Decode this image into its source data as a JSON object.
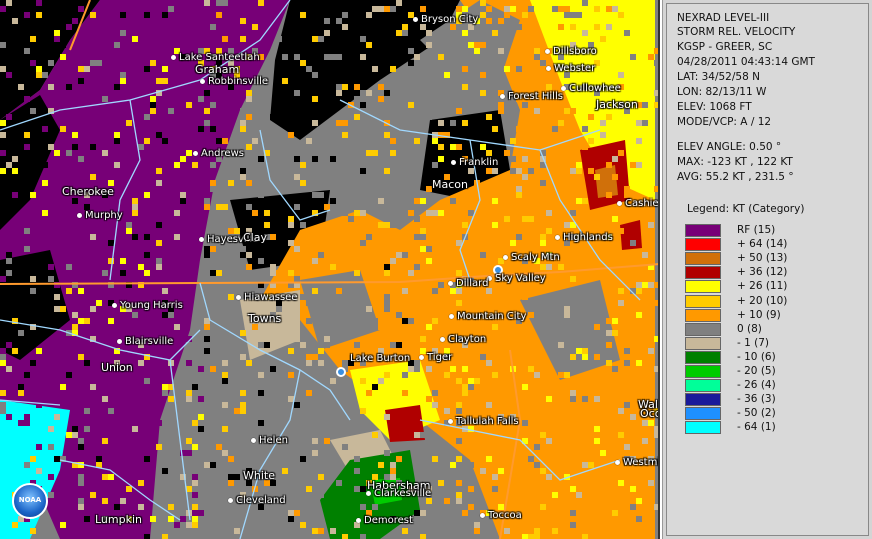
{
  "info": {
    "lines_top": [
      "NEXRAD LEVEL-III",
      "STORM REL. VELOCITY",
      "KGSP - GREER, SC",
      "04/28/2011 04:43:14 GMT",
      "LAT: 34/52/58 N",
      "LON: 82/13/11 W",
      "ELEV: 1068 FT",
      "MODE/VCP: A / 12"
    ],
    "lines_stats": [
      "ELEV ANGLE: 0.50 °",
      "MAX: -123 KT , 122 KT",
      "AVG: 55.2 KT , 231.5 °"
    ]
  },
  "legend": {
    "title": "Legend: KT (Category)",
    "items": [
      {
        "label": "RF  (15)",
        "color": "#770077"
      },
      {
        "label": "+ 64  (14)",
        "color": "#ff0000"
      },
      {
        "label": "+ 50  (13)",
        "color": "#d0700a"
      },
      {
        "label": "+ 36  (12)",
        "color": "#b00000"
      },
      {
        "label": "+ 26  (11)",
        "color": "#ffff00"
      },
      {
        "label": "+ 20  (10)",
        "color": "#ffcc00"
      },
      {
        "label": "+ 10  (9)",
        "color": "#ff9900"
      },
      {
        "label": "0  (8)",
        "color": "#808080"
      },
      {
        "label": "- 1  (7)",
        "color": "#c8b89a"
      },
      {
        "label": "- 10  (6)",
        "color": "#008000"
      },
      {
        "label": "- 20  (5)",
        "color": "#00cc00"
      },
      {
        "label": "- 26  (4)",
        "color": "#00ff99"
      },
      {
        "label": "- 36  (3)",
        "color": "#1a1a9a"
      },
      {
        "label": "- 50  (2)",
        "color": "#1e90ff"
      },
      {
        "label": "- 64  (1)",
        "color": "#00ffff"
      }
    ]
  },
  "places": [
    {
      "name": "Bryson City",
      "dot": true
    },
    {
      "name": "Lake Santeetlah",
      "dot": true
    },
    {
      "name": "Graham",
      "dot": false
    },
    {
      "name": "Robbinsville",
      "dot": true
    },
    {
      "name": "Dillsboro",
      "dot": true
    },
    {
      "name": "Webster",
      "dot": true
    },
    {
      "name": "Forest Hills",
      "dot": true
    },
    {
      "name": "Cullowhee",
      "dot": true
    },
    {
      "name": "Jackson",
      "dot": false
    },
    {
      "name": "Andrews",
      "dot": true
    },
    {
      "name": "Franklin",
      "dot": true
    },
    {
      "name": "Macon",
      "dot": false
    },
    {
      "name": "Cherokee",
      "dot": false
    },
    {
      "name": "Cashiers",
      "dot": true
    },
    {
      "name": "Murphy",
      "dot": true
    },
    {
      "name": "Hayesville",
      "dot": true
    },
    {
      "name": "Clay",
      "dot": false
    },
    {
      "name": "Highlands",
      "dot": true
    },
    {
      "name": "Scaly Mtn",
      "dot": true
    },
    {
      "name": "Sky Valley",
      "dot": true
    },
    {
      "name": "Dillard",
      "dot": true
    },
    {
      "name": "Hiawassee",
      "dot": true
    },
    {
      "name": "Young Harris",
      "dot": true
    },
    {
      "name": "Towns",
      "dot": false
    },
    {
      "name": "Mountain City",
      "dot": true
    },
    {
      "name": "Clayton",
      "dot": true
    },
    {
      "name": "Blairsville",
      "dot": true
    },
    {
      "name": "Lake Burton",
      "dot": false
    },
    {
      "name": "Tiger",
      "dot": true
    },
    {
      "name": "Union",
      "dot": false
    },
    {
      "name": "Tallulah Falls",
      "dot": true
    },
    {
      "name": "Helen",
      "dot": true
    },
    {
      "name": "White",
      "dot": false
    },
    {
      "name": "Habersham",
      "dot": false
    },
    {
      "name": "Clarkesville",
      "dot": true
    },
    {
      "name": "Cleveland",
      "dot": true
    },
    {
      "name": "Westmi",
      "dot": true
    },
    {
      "name": "Wal",
      "dot": false
    },
    {
      "name": "Oco",
      "dot": false
    },
    {
      "name": "Lumpkin",
      "dot": false
    },
    {
      "name": "Demorest",
      "dot": true
    },
    {
      "name": "Toccoa",
      "dot": true
    }
  ],
  "logo": {
    "text": "NOAA"
  }
}
